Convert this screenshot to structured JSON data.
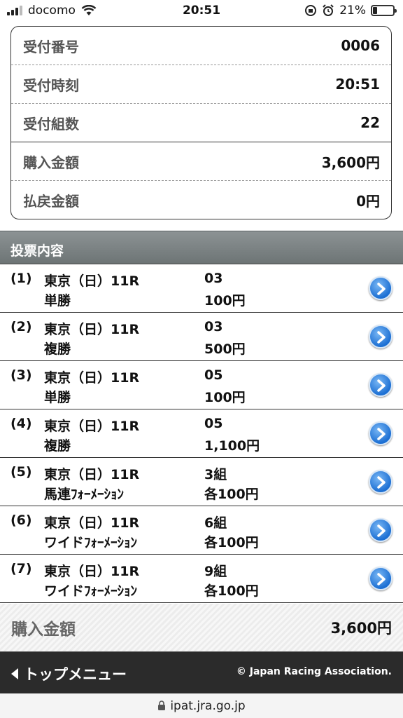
{
  "status_bar": {
    "carrier": "docomo",
    "time": "20:51",
    "battery_percent": "21%",
    "battery_level": 0.21
  },
  "summary": {
    "rows": [
      {
        "label": "受付番号",
        "value": "0006"
      },
      {
        "label": "受付時刻",
        "value": "20:51"
      },
      {
        "label": "受付組数",
        "value": "22"
      },
      {
        "label": "購入金額",
        "value": "3,600円"
      },
      {
        "label": "払戻金額",
        "value": "0円"
      }
    ]
  },
  "section_title": "投票内容",
  "bets": [
    {
      "num": "(1)",
      "race": "東京（日）11R",
      "type": "単勝",
      "selection": "03",
      "amount": "100円"
    },
    {
      "num": "(2)",
      "race": "東京（日）11R",
      "type": "複勝",
      "selection": "03",
      "amount": "500円"
    },
    {
      "num": "(3)",
      "race": "東京（日）11R",
      "type": "単勝",
      "selection": "05",
      "amount": "100円"
    },
    {
      "num": "(4)",
      "race": "東京（日）11R",
      "type": "複勝",
      "selection": "05",
      "amount": "1,100円"
    },
    {
      "num": "(5)",
      "race": "東京（日）11R",
      "type": "馬連ﾌｫｰﾒｰｼｮﾝ",
      "selection": "3組",
      "amount": "各100円"
    },
    {
      "num": "(6)",
      "race": "東京（日）11R",
      "type": "ワイドﾌｫｰﾒｰｼｮﾝ",
      "selection": "6組",
      "amount": "各100円"
    },
    {
      "num": "(7)",
      "race": "東京（日）11R",
      "type": "ワイドﾌｫｰﾒｰｼｮﾝ",
      "selection": "9組",
      "amount": "各100円"
    }
  ],
  "total": {
    "label": "購入金額",
    "value": "3,600円"
  },
  "footer": {
    "back_label": "トップメニュー",
    "copyright": "© Japan Racing Association."
  },
  "url": "ipat.jra.go.jp",
  "colors": {
    "header_bg": "#7d8485",
    "footer_bg": "#2b2b2b",
    "arrow_blue": "#1c6fd3"
  }
}
